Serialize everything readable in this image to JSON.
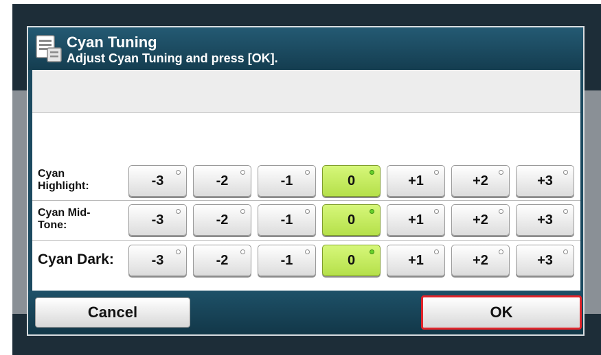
{
  "dialog": {
    "title": "Cyan Tuning",
    "subtitle": "Adjust Cyan Tuning and press [OK]."
  },
  "rows": [
    {
      "label_line1": "Cyan",
      "label_line2": "Highlight:",
      "selected": "0"
    },
    {
      "label_line1": "Cyan Mid-",
      "label_line2": "Tone:",
      "selected": "0"
    },
    {
      "label": "Cyan Dark:",
      "selected": "0"
    }
  ],
  "values": [
    "-3",
    "-2",
    "-1",
    "0",
    "+1",
    "+2",
    "+3"
  ],
  "footer": {
    "cancel_label": "Cancel",
    "ok_label": "OK"
  },
  "colors": {
    "title_bar": "#1c4a60",
    "selected_button": "#c6ec5e",
    "ok_border": "#e0242a"
  },
  "icons": {
    "title": "document-settings-icon"
  }
}
